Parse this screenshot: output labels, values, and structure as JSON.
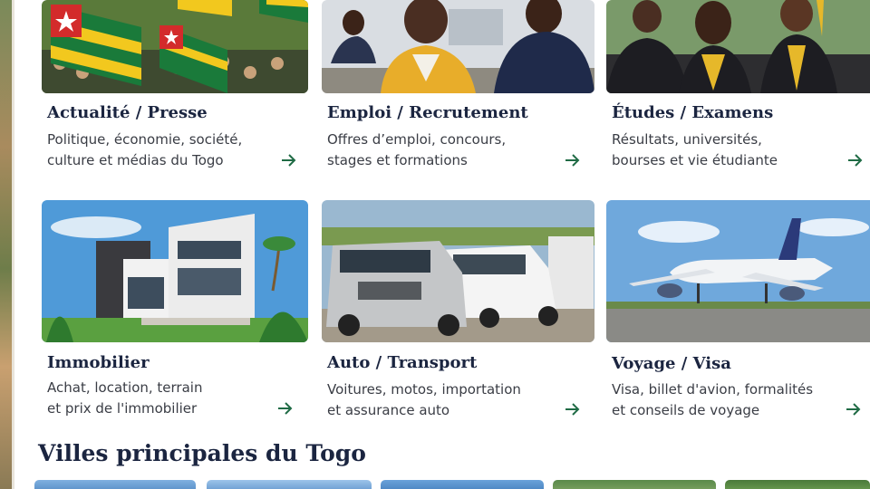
{
  "categories": [
    {
      "title": "Actualité / Presse",
      "desc": [
        "Politique, économie, société,",
        "culture et médias du Togo"
      ]
    },
    {
      "title": "Emploi / Recrutement",
      "desc": [
        "Offres d’emploi, concours,",
        "stages et formations"
      ]
    },
    {
      "title": "Études / Examens",
      "desc": [
        "Résultats, universités,",
        "bourses et vie étudiante"
      ]
    },
    {
      "title": "Immobilier",
      "desc": [
        "Achat, location, terrain",
        "et prix de l'immobilier"
      ]
    },
    {
      "title": "Auto / Transport",
      "desc": [
        "Voitures, motos, importation",
        "et assurance auto"
      ]
    },
    {
      "title": "Voyage / Visa",
      "desc": [
        "Visa, billet d'avion, formalités",
        "et conseils de voyage"
      ]
    }
  ],
  "arrow_icon": "arrow-right-icon",
  "arrow_color": "#1f6b45",
  "section": {
    "title": "Villes principales du Togo"
  }
}
